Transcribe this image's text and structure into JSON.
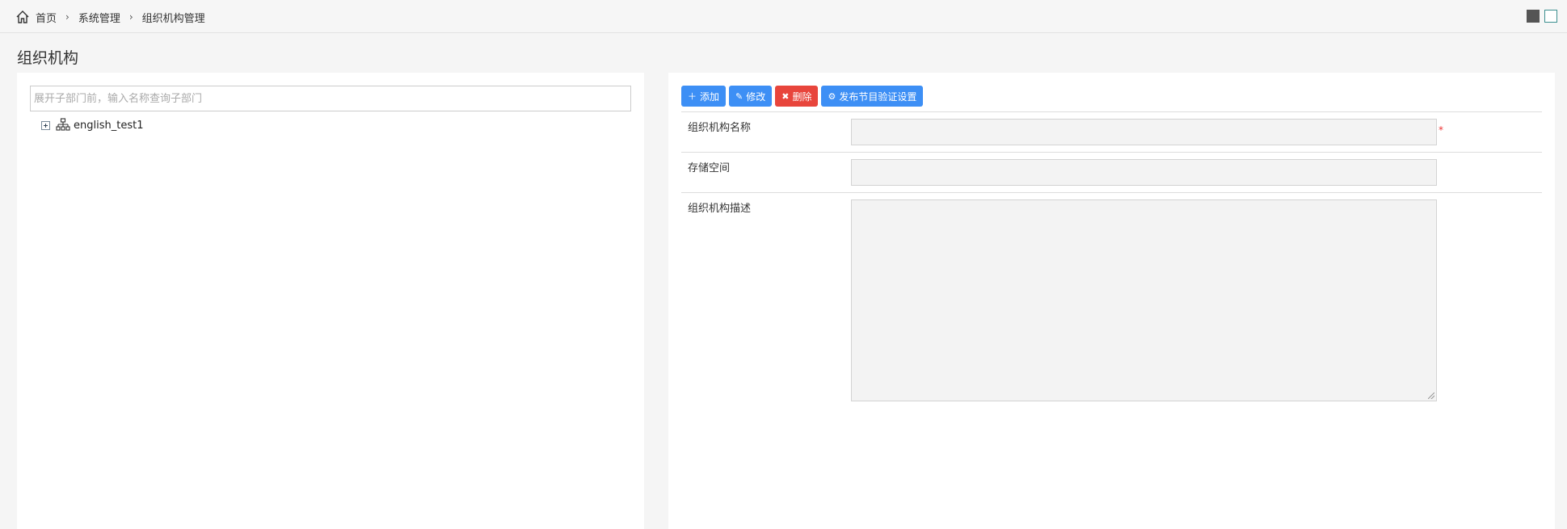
{
  "breadcrumb": {
    "home": "首页",
    "level1": "系统管理",
    "level2": "组织机构管理"
  },
  "page": {
    "title": "组织机构"
  },
  "tree": {
    "search_placeholder": "展开子部门前，输入名称查询子部门",
    "nodes": [
      {
        "label": "english_test1",
        "icon": "org-chart-icon",
        "expanded": false
      }
    ]
  },
  "toolbar": {
    "add_label": "添加",
    "edit_label": "修改",
    "delete_label": "删除",
    "publish_label": "发布节目验证设置"
  },
  "form": {
    "name_label": "组织机构名称",
    "name_value": "",
    "required_mark": "*",
    "storage_label": "存储空间",
    "storage_value": "",
    "desc_label": "组织机构描述",
    "desc_value": ""
  },
  "colors": {
    "primary": "#3d8ff5",
    "danger": "#e8453c",
    "required": "#ee3333"
  }
}
